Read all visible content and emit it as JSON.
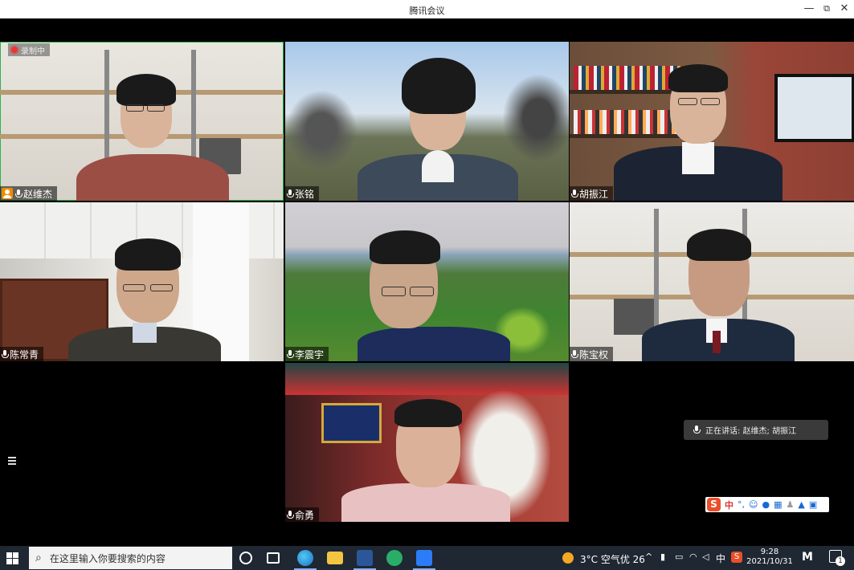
{
  "window": {
    "title": "腾讯会议",
    "controls": {
      "minimize": "—",
      "restore": "⧉",
      "close": "✕"
    }
  },
  "meeting": {
    "recording_label": "录制中",
    "speaking_label": "正在讲话: 赵维杰; 胡振江",
    "participants": [
      {
        "name": "赵维杰",
        "host": true,
        "speaking": true
      },
      {
        "name": "张铭",
        "host": false
      },
      {
        "name": "胡振江",
        "host": false
      },
      {
        "name": "陈常青",
        "host": false
      },
      {
        "name": "李震宇",
        "host": false
      },
      {
        "name": "陈宝权",
        "host": false
      },
      {
        "name": "俞勇",
        "host": false
      }
    ]
  },
  "ime_toolbar": {
    "logo": "S",
    "mode": "中",
    "icons": [
      "punctuation-icon",
      "emoji-icon",
      "voice-icon",
      "keyboard-icon",
      "user-icon",
      "skin-icon",
      "grid-icon"
    ]
  },
  "taskbar": {
    "search_placeholder": "在这里输入你要搜索的内容",
    "weather": "3°C 空气优 26",
    "ime_indicator": "中",
    "time": "9:28",
    "date": "2021/10/31",
    "notification_count": "1",
    "colors": {
      "background": "#1f2732",
      "accent": "#8ab4f8"
    }
  }
}
